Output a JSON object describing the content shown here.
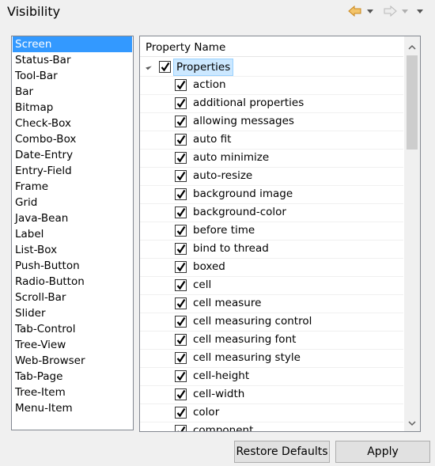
{
  "title": "Visibility",
  "toolbar": {
    "back_icon": "arrow-left-icon",
    "forward_icon": "arrow-right-icon",
    "menu_icon": "chevron-down-icon",
    "accent_color": "#e8a33c"
  },
  "list": {
    "items": [
      "Screen",
      "Status-Bar",
      "Tool-Bar",
      "Bar",
      "Bitmap",
      "Check-Box",
      "Combo-Box",
      "Date-Entry",
      "Entry-Field",
      "Frame",
      "Grid",
      "Java-Bean",
      "Label",
      "List-Box",
      "Push-Button",
      "Radio-Button",
      "Scroll-Bar",
      "Slider",
      "Tab-Control",
      "Tree-View",
      "Web-Browser",
      "Tab-Page",
      "Tree-Item",
      "Menu-Item"
    ],
    "selected": "Screen",
    "selected_color": "#3399ff"
  },
  "tree": {
    "header": "Property Name",
    "root": {
      "label": "Properties",
      "checked": true
    },
    "items": [
      "action",
      "additional properties",
      "allowing messages",
      "auto fit",
      "auto minimize",
      "auto-resize",
      "background image",
      "background-color",
      "before time",
      "bind to thread",
      "boxed",
      "cell",
      "cell measure",
      "cell measuring control",
      "cell measuring font",
      "cell measuring style",
      "cell-height",
      "cell-width",
      "color",
      "component"
    ]
  },
  "buttons": {
    "restore": "Restore Defaults",
    "apply": "Apply"
  }
}
